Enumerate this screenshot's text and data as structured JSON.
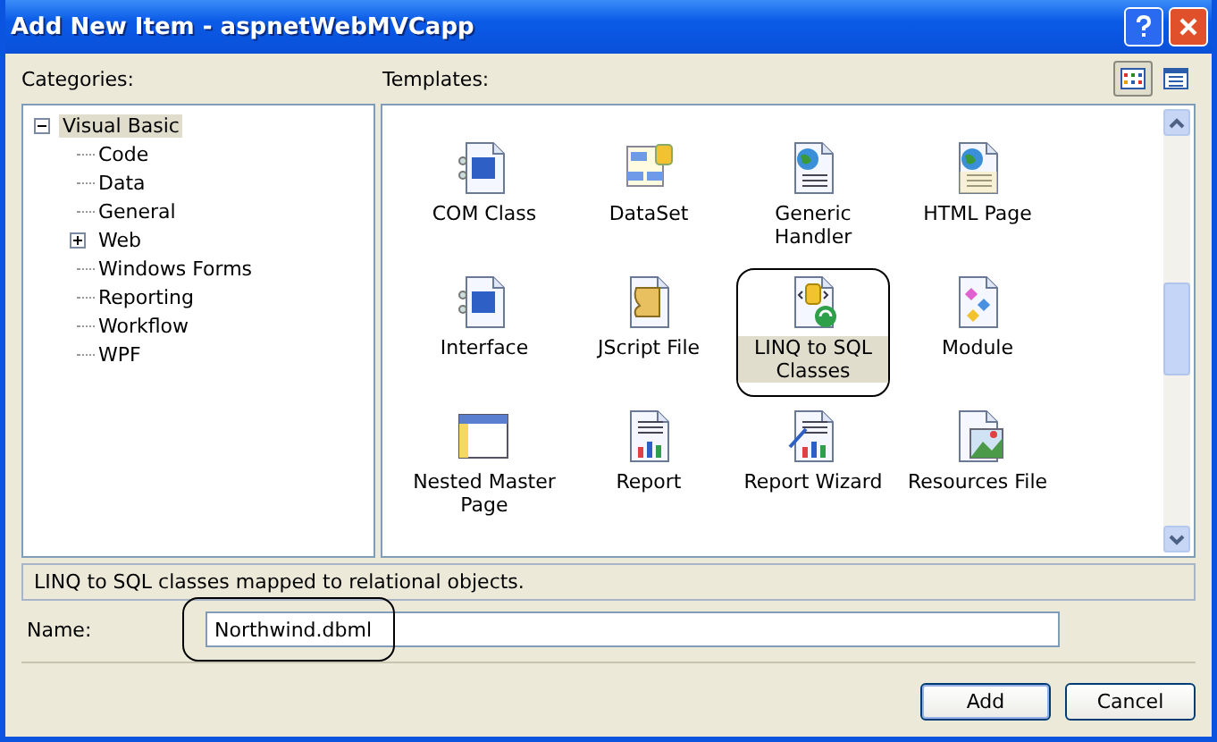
{
  "window": {
    "title": "Add New Item - aspnetWebMVCapp"
  },
  "categories": {
    "label": "Categories:",
    "tree": [
      {
        "label": "Visual Basic",
        "selected": true,
        "expanded": true,
        "children": [
          {
            "label": "Code",
            "kind": "leaf"
          },
          {
            "label": "Data",
            "kind": "leaf"
          },
          {
            "label": "General",
            "kind": "leaf"
          },
          {
            "label": "Web",
            "kind": "folder",
            "expanded": false
          },
          {
            "label": "Windows Forms",
            "kind": "leaf"
          },
          {
            "label": "Reporting",
            "kind": "leaf"
          },
          {
            "label": "Workflow",
            "kind": "leaf"
          },
          {
            "label": "WPF",
            "kind": "leaf"
          }
        ]
      }
    ]
  },
  "templates": {
    "label": "Templates:",
    "view_modes": [
      {
        "selected": true
      },
      {
        "selected": false
      }
    ],
    "items": [
      {
        "label": "COM Class",
        "selected": false
      },
      {
        "label": "DataSet",
        "selected": false
      },
      {
        "label": "Generic Handler",
        "selected": false
      },
      {
        "label": "HTML Page",
        "selected": false
      },
      {
        "label": "Interface",
        "selected": false
      },
      {
        "label": "JScript File",
        "selected": false
      },
      {
        "label": "LINQ to SQL Classes",
        "selected": true
      },
      {
        "label": "Module",
        "selected": false
      },
      {
        "label": "Nested Master Page",
        "selected": false
      },
      {
        "label": "Report",
        "selected": false
      },
      {
        "label": "Report Wizard",
        "selected": false
      },
      {
        "label": "Resources File",
        "selected": false
      }
    ]
  },
  "description": "LINQ to SQL classes mapped to relational objects.",
  "name_field": {
    "label": "Name:",
    "value": "Northwind.dbml"
  },
  "buttons": [
    {
      "label": "Add",
      "default": true
    },
    {
      "label": "Cancel",
      "default": false
    }
  ]
}
